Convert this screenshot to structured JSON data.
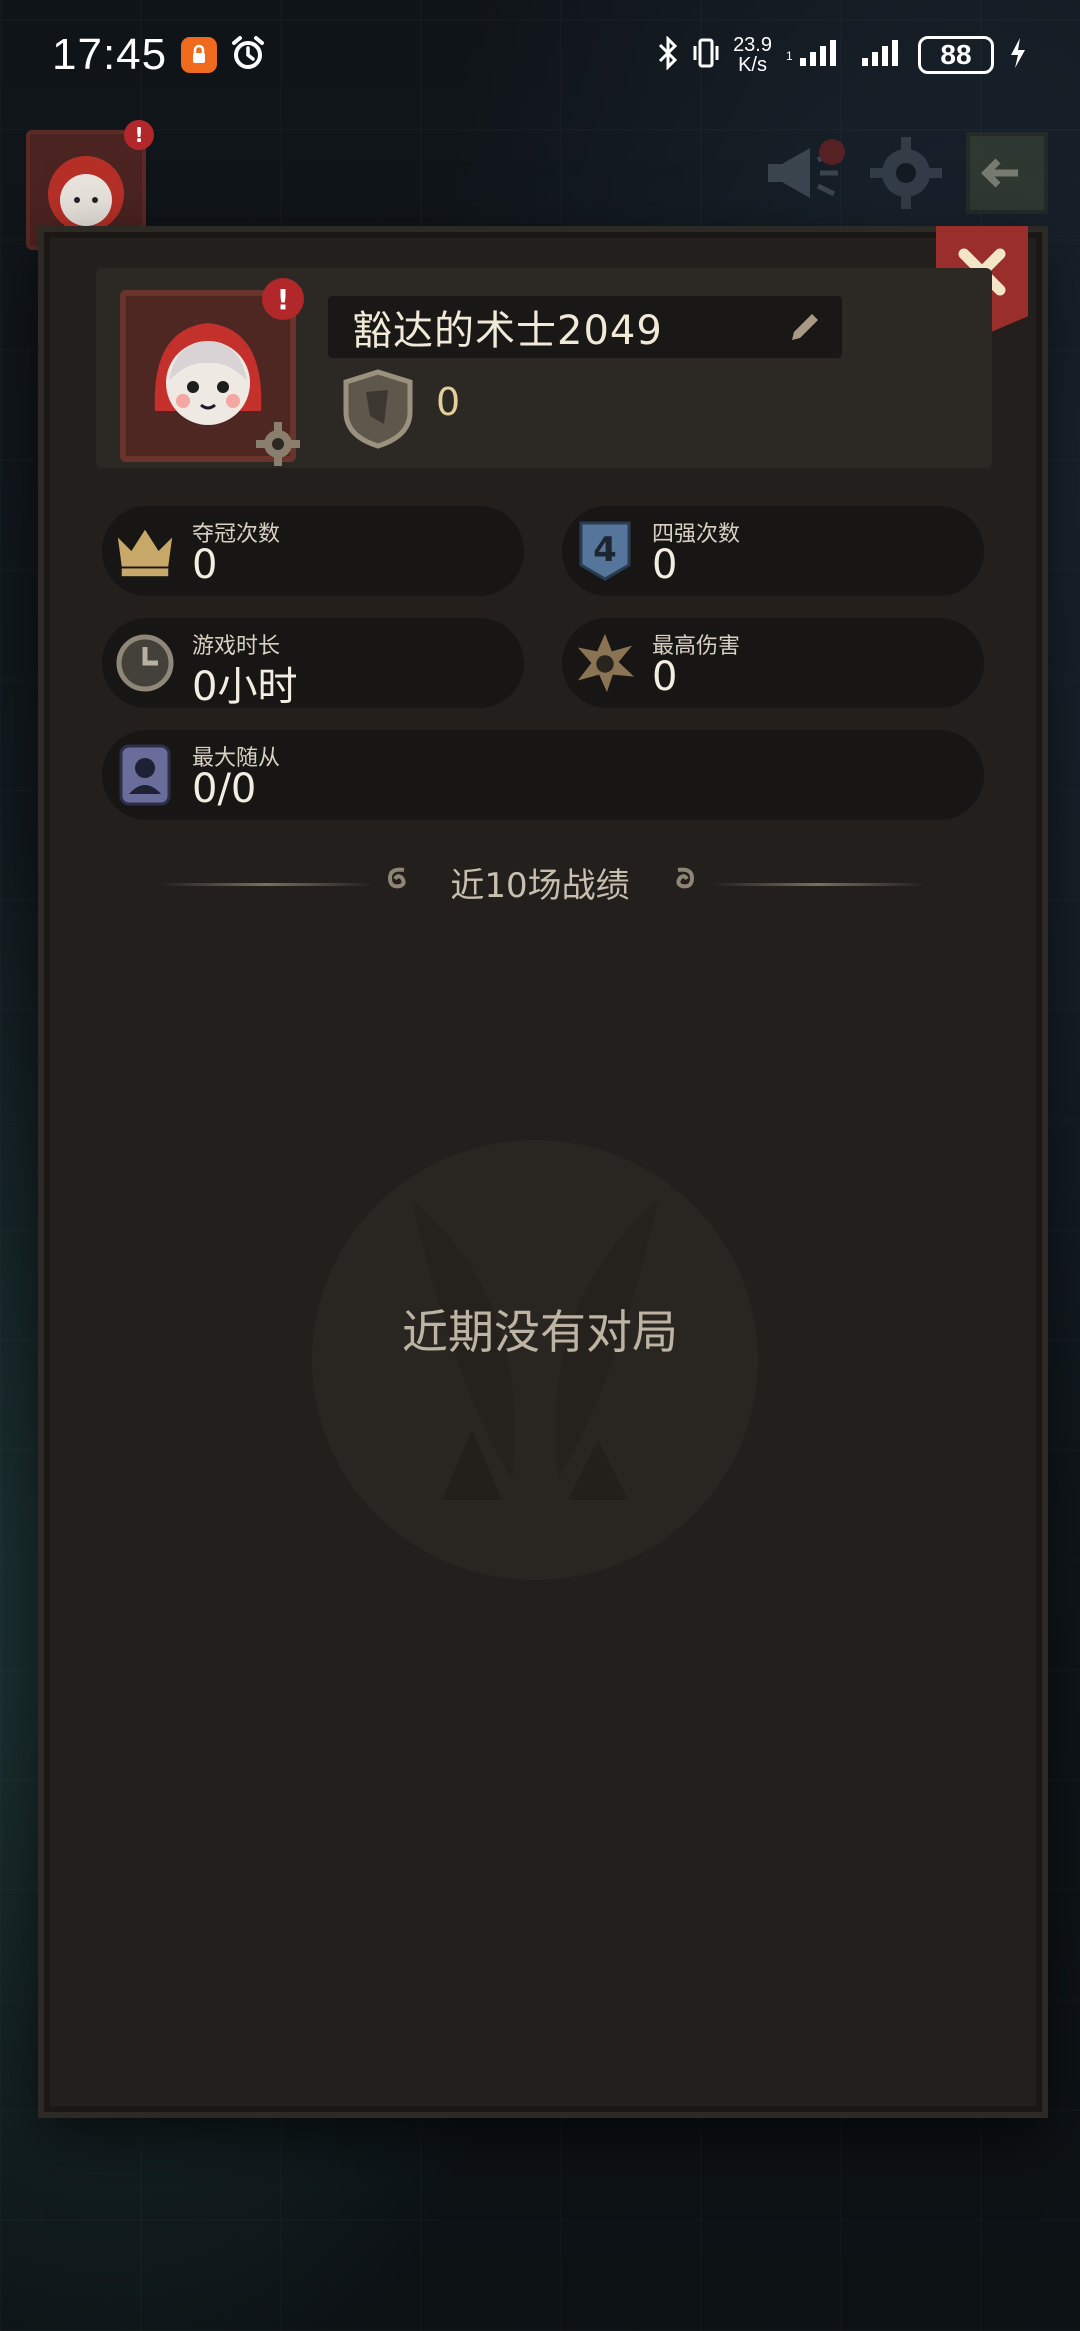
{
  "status_bar": {
    "time": "17:45",
    "net_speed_value": "23.9",
    "net_speed_unit": "K/s",
    "battery": "88"
  },
  "profile": {
    "player_name": "豁达的术士2049",
    "rank_value": "0"
  },
  "stats": {
    "championships": {
      "label": "夺冠次数",
      "value": "0"
    },
    "top4": {
      "label": "四强次数",
      "value": "0"
    },
    "play_time": {
      "label": "游戏时长",
      "value": "0小时"
    },
    "max_damage": {
      "label": "最高伤害",
      "value": "0"
    },
    "max_followers": {
      "label": "最大随从",
      "value": "0/0"
    }
  },
  "history": {
    "title": "近10场战绩",
    "empty_text": "近期没有对局"
  },
  "colors": {
    "accent_red": "#b2282a",
    "panel_bg": "#221f1c",
    "gold": "#e4cf99"
  },
  "icons": {
    "close": "close-icon",
    "settings": "gear-icon",
    "announce": "megaphone-icon",
    "back": "exit-icon"
  }
}
